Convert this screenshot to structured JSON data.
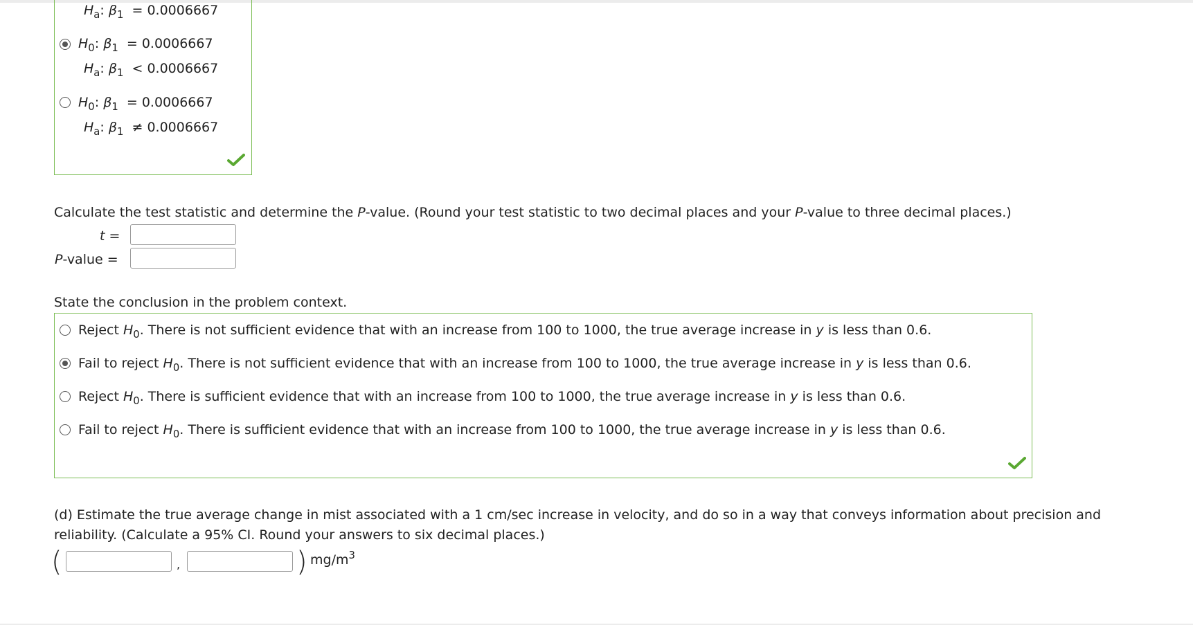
{
  "hypotheses_prev": {
    "partial_alt": {
      "sym": "H",
      "sub": "a",
      "beta": "β",
      "bsub": "1",
      "op": "=",
      "val": "0.0006667"
    },
    "options": [
      {
        "selected": true,
        "null": {
          "sym": "H",
          "sub": "0",
          "beta": "β",
          "bsub": "1",
          "op": "=",
          "val": "0.0006667"
        },
        "alt": {
          "sym": "H",
          "sub": "a",
          "beta": "β",
          "bsub": "1",
          "op": "<",
          "val": "0.0006667"
        }
      },
      {
        "selected": false,
        "null": {
          "sym": "H",
          "sub": "0",
          "beta": "β",
          "bsub": "1",
          "op": "=",
          "val": "0.0006667"
        },
        "alt": {
          "sym": "H",
          "sub": "a",
          "beta": "β",
          "bsub": "1",
          "op": "≠",
          "val": "0.0006667"
        }
      }
    ]
  },
  "test_stat": {
    "instruction_pre": "Calculate the test statistic and determine the ",
    "instruction_p": "P",
    "instruction_mid": "-value. (Round your test statistic to two decimal places and your ",
    "instruction_p2": "P",
    "instruction_post": "-value to three decimal places.)",
    "t_label": "t",
    "eq": "=",
    "p_label_i": "P",
    "p_label_rest": "-value",
    "t_value": "",
    "p_value": ""
  },
  "conclusion": {
    "prompt": "State the conclusion in the problem context.",
    "options": [
      {
        "selected": false,
        "pre": "Reject ",
        "h": "H",
        "hsub": "0",
        "post": ". There is not sufficient evidence that with an increase from 100 to 1000, the true average increase in ",
        "y": "y",
        "tail": " is less than 0.6."
      },
      {
        "selected": true,
        "pre": "Fail to reject ",
        "h": "H",
        "hsub": "0",
        "post": ". There is not sufficient evidence that with an increase from 100 to 1000, the true average increase in ",
        "y": "y",
        "tail": " is less than 0.6."
      },
      {
        "selected": false,
        "pre": "Reject ",
        "h": "H",
        "hsub": "0",
        "post": ". There is sufficient evidence that with an increase from 100 to 1000, the true average increase in ",
        "y": "y",
        "tail": " is less than 0.6."
      },
      {
        "selected": false,
        "pre": "Fail to reject ",
        "h": "H",
        "hsub": "0",
        "post": ". There is sufficient evidence that with an increase from 100 to 1000, the true average increase in ",
        "y": "y",
        "tail": " is less than 0.6."
      }
    ]
  },
  "part_d": {
    "line1": "(d) Estimate the true average change in mist associated with a 1 cm/sec increase in velocity, and do so in a way that conveys information about precision and",
    "line2": "reliability. (Calculate a 95% CI. Round your answers to six decimal places.)",
    "open_paren": "(",
    "comma": ",",
    "close_paren": ")",
    "unit": "mg/m",
    "unit_sup": "3",
    "lower": "",
    "upper": ""
  },
  "colors": {
    "check": "#5aa832",
    "box_border": "#7bbd54"
  },
  "icons": [
    "checkmark-icon",
    "radio-icon"
  ]
}
